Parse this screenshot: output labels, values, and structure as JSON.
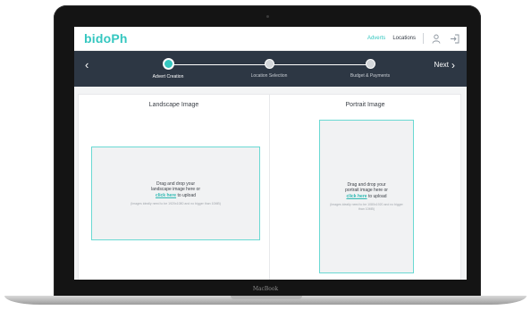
{
  "device": {
    "label": "MacBook"
  },
  "header": {
    "logo": "bidoPh",
    "nav": [
      {
        "label": "Adverts",
        "active": true
      },
      {
        "label": "Locations",
        "active": false
      }
    ],
    "icons": [
      "user-icon",
      "logout-icon"
    ]
  },
  "progress": {
    "back_label": "‹",
    "next_label": "Next",
    "next_chevron": "›",
    "steps": [
      {
        "label": "Advert Creation",
        "active": true
      },
      {
        "label": "Location Selection",
        "active": false
      },
      {
        "label": "Budget & Payments",
        "active": false
      }
    ]
  },
  "panels": {
    "landscape": {
      "title": "Landscape Image",
      "line1": "Drag and drop your",
      "line2": "landscape image here or",
      "link": "click here",
      "after_link": "to upload",
      "hint": "(Images ideally need to be 1920x1080 and no bigger than 10MB)"
    },
    "portrait": {
      "title": "Portrait Image",
      "line1": "Drag and drop your",
      "line2": "portrait image here or",
      "link": "click here",
      "after_link": "to upload",
      "hint": "(Images ideally need to be 1080x1920 and no bigger than 10MB)"
    }
  },
  "colors": {
    "accent": "#35c7c0",
    "bar": "#2d3744"
  }
}
